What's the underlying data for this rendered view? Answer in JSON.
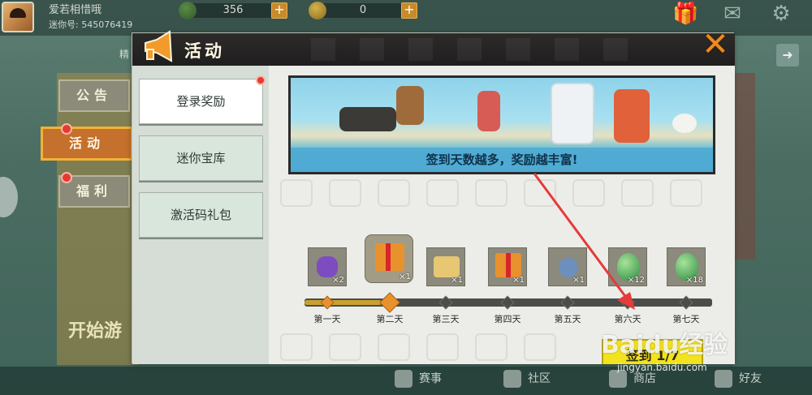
{
  "player": {
    "name": "爱若相惜哦",
    "id_text": "迷你号: 545076419"
  },
  "currencies": [
    {
      "icon": "green-bean-icon",
      "value": "356"
    },
    {
      "icon": "gold-coin-icon",
      "value": "0"
    }
  ],
  "background": {
    "elite_text": "精",
    "start_text": "开始游"
  },
  "side_tabs": [
    {
      "label": "公告"
    },
    {
      "label": "活动"
    },
    {
      "label": "福利"
    }
  ],
  "dialog": {
    "title": "活动",
    "menu": [
      {
        "label": "登录奖励"
      },
      {
        "label": "迷你宝库"
      },
      {
        "label": "激活码礼包"
      }
    ],
    "banner_caption": "签到天数越多，奖励越丰富!",
    "rewards": [
      {
        "day": "第一天",
        "qty": "×2",
        "item": "lucky-bag-icon",
        "claimed": true
      },
      {
        "day": "第二天",
        "qty": "×1",
        "item": "gift-box-icon",
        "claimed": true,
        "current": true
      },
      {
        "day": "第三天",
        "qty": "×1",
        "item": "scroll-icon",
        "claimed": false
      },
      {
        "day": "第四天",
        "qty": "×1",
        "item": "gift-box-icon",
        "claimed": false
      },
      {
        "day": "第五天",
        "qty": "×1",
        "item": "brush-icon",
        "claimed": false
      },
      {
        "day": "第六天",
        "qty": "×12",
        "item": "green-egg-icon",
        "claimed": false
      },
      {
        "day": "第七天",
        "qty": "×18",
        "item": "green-egg-icon",
        "claimed": false
      }
    ],
    "checkin_button": "签到 1/7",
    "progress": 0.19
  },
  "bottom_nav": [
    {
      "label": "赛事"
    },
    {
      "label": "社区"
    },
    {
      "label": "商店"
    },
    {
      "label": "好友"
    }
  ],
  "watermark": {
    "brand": "Baidu经验",
    "url": "jingyan.baidu.com"
  },
  "colors": {
    "accent_orange": "#e8922e",
    "checkin_yellow": "#f3e21e",
    "close_orange": "#f08a1f",
    "red_dot": "#e63a2e"
  }
}
